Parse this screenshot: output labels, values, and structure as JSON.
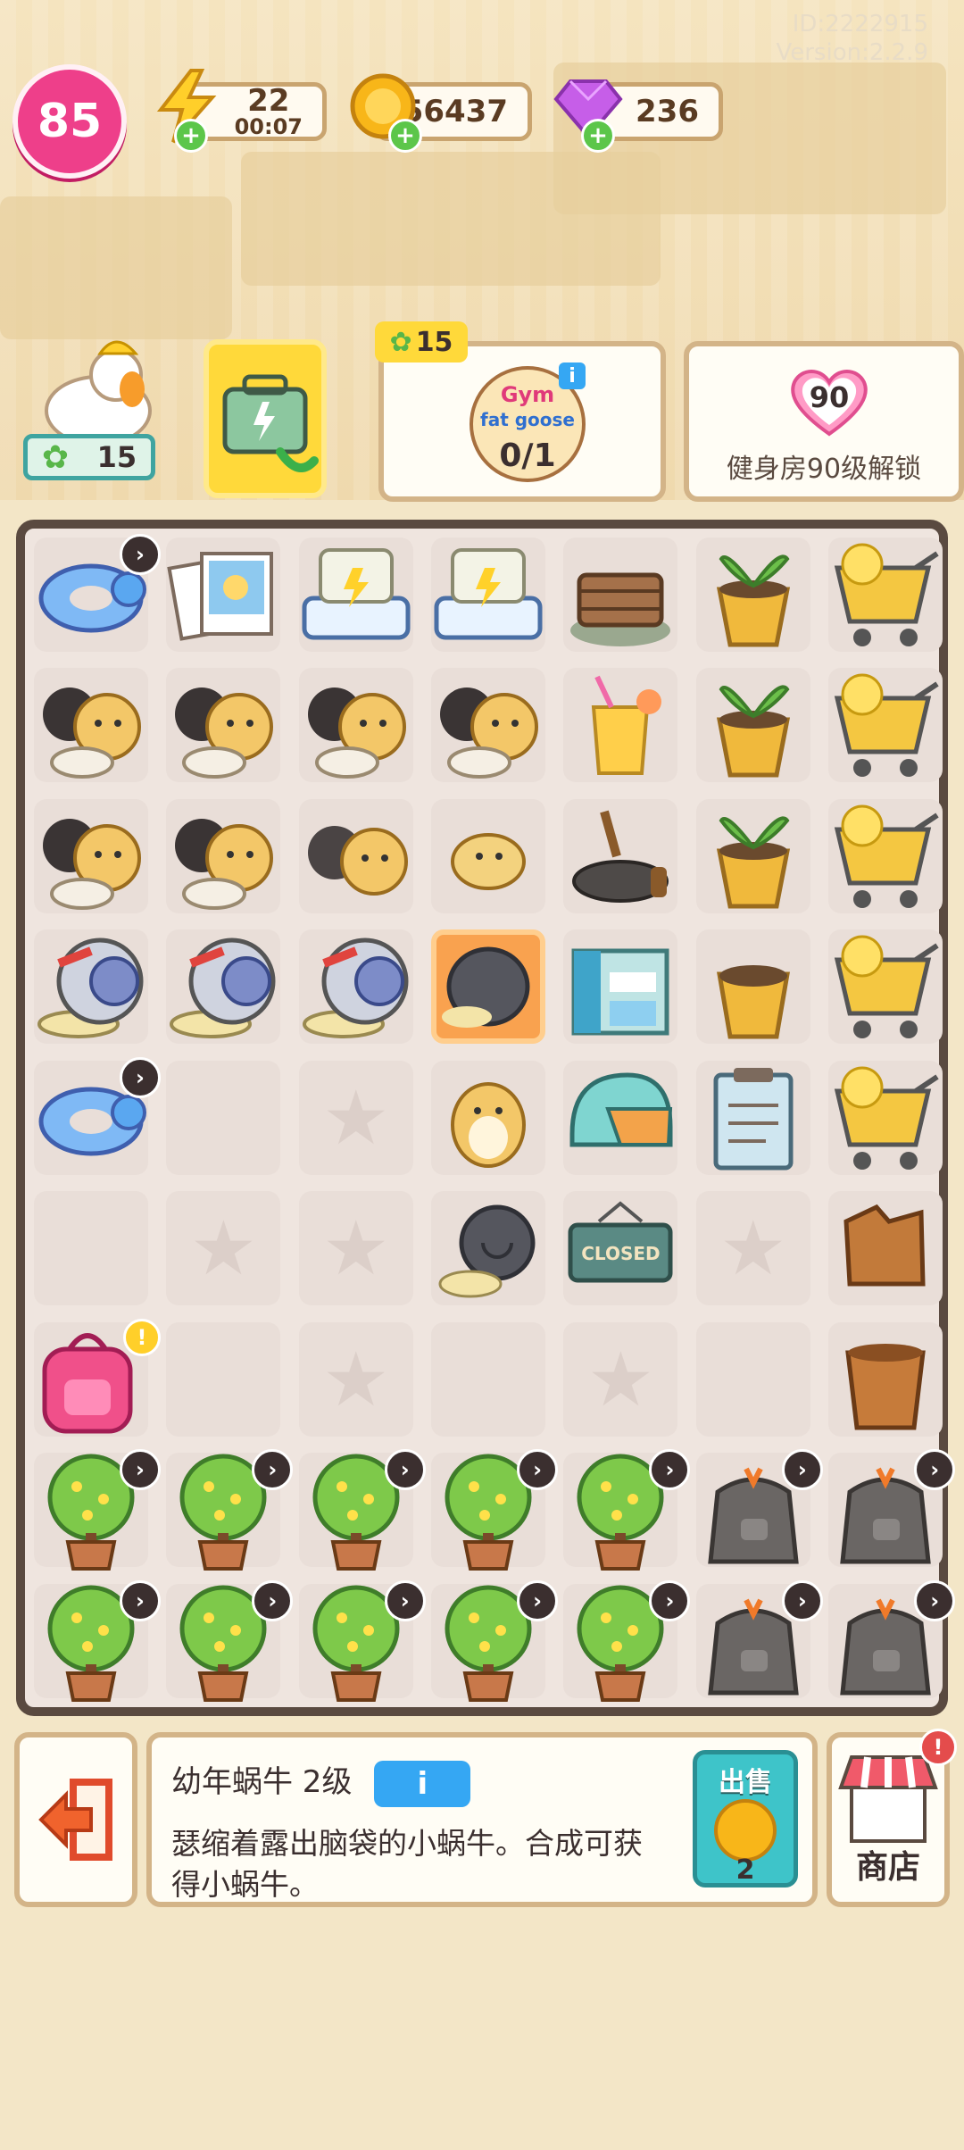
{
  "hud": {
    "id_text": "ID:2222915",
    "version_text": "Version:2.2.9",
    "level": "85",
    "energy": "22",
    "energy_timer": "00:07",
    "coins": "56437",
    "gems": "236"
  },
  "top_panels": {
    "clover_count": "15",
    "gym_clover_count": "15",
    "gym_progress": "0/1",
    "gym_logo_top": "Gym",
    "gym_logo_bottom": "fat goose",
    "unlock_level": "90",
    "unlock_text": "健身房90级解锁"
  },
  "board": {
    "rows": [
      [
        "swim-ring",
        "photo-frames",
        "treadmill",
        "treadmill",
        "woodpile",
        "sprout-pot",
        "shopping-cart"
      ],
      [
        "hamster-family",
        "hamster-family",
        "hamster-family",
        "hamster-family",
        "orange-juice",
        "sprout-pot",
        "shopping-cart"
      ],
      [
        "hamster-family",
        "hamster-family",
        "hamster-pair",
        "baby-hamster",
        "frying-pan",
        "sprout-pot",
        "shopping-cart"
      ],
      [
        "snail-helmet",
        "snail-helmet",
        "snail-helmet",
        "baby-snail",
        "gym-building",
        "soil-pot",
        "shopping-cart"
      ],
      [
        "swim-ring",
        "empty",
        "star",
        "hamster",
        "cycling-helmet",
        "clipboard",
        "shopping-cart"
      ],
      [
        "empty",
        "star",
        "star",
        "snail",
        "closed-sign",
        "star",
        "broken-stump"
      ],
      [
        "backpack",
        "empty",
        "star",
        "empty",
        "star",
        "empty",
        "wooden-bucket"
      ],
      [
        "flower-tree",
        "flower-tree",
        "flower-tree",
        "flower-tree",
        "flower-tree",
        "trash-bag",
        "trash-bag"
      ],
      [
        "flower-tree",
        "flower-tree",
        "flower-tree",
        "flower-tree",
        "flower-tree",
        "trash-bag",
        "trash-bag"
      ]
    ],
    "closed_sign_text": "CLOSED"
  },
  "info_panel": {
    "item_name": "幼年蜗牛 2级",
    "info_button": "i",
    "description": "瑟缩着露出脑袋的小蜗牛。合成可获得小蜗牛。",
    "sell_label": "出售",
    "sell_price": "2"
  },
  "shop": {
    "label": "商店",
    "alert": "!"
  },
  "colors": {
    "accent_pink": "#ee3f8a",
    "board_border": "#5a4a40",
    "sell_teal": "#3ec4c9",
    "info_blue": "#35a7f3"
  }
}
